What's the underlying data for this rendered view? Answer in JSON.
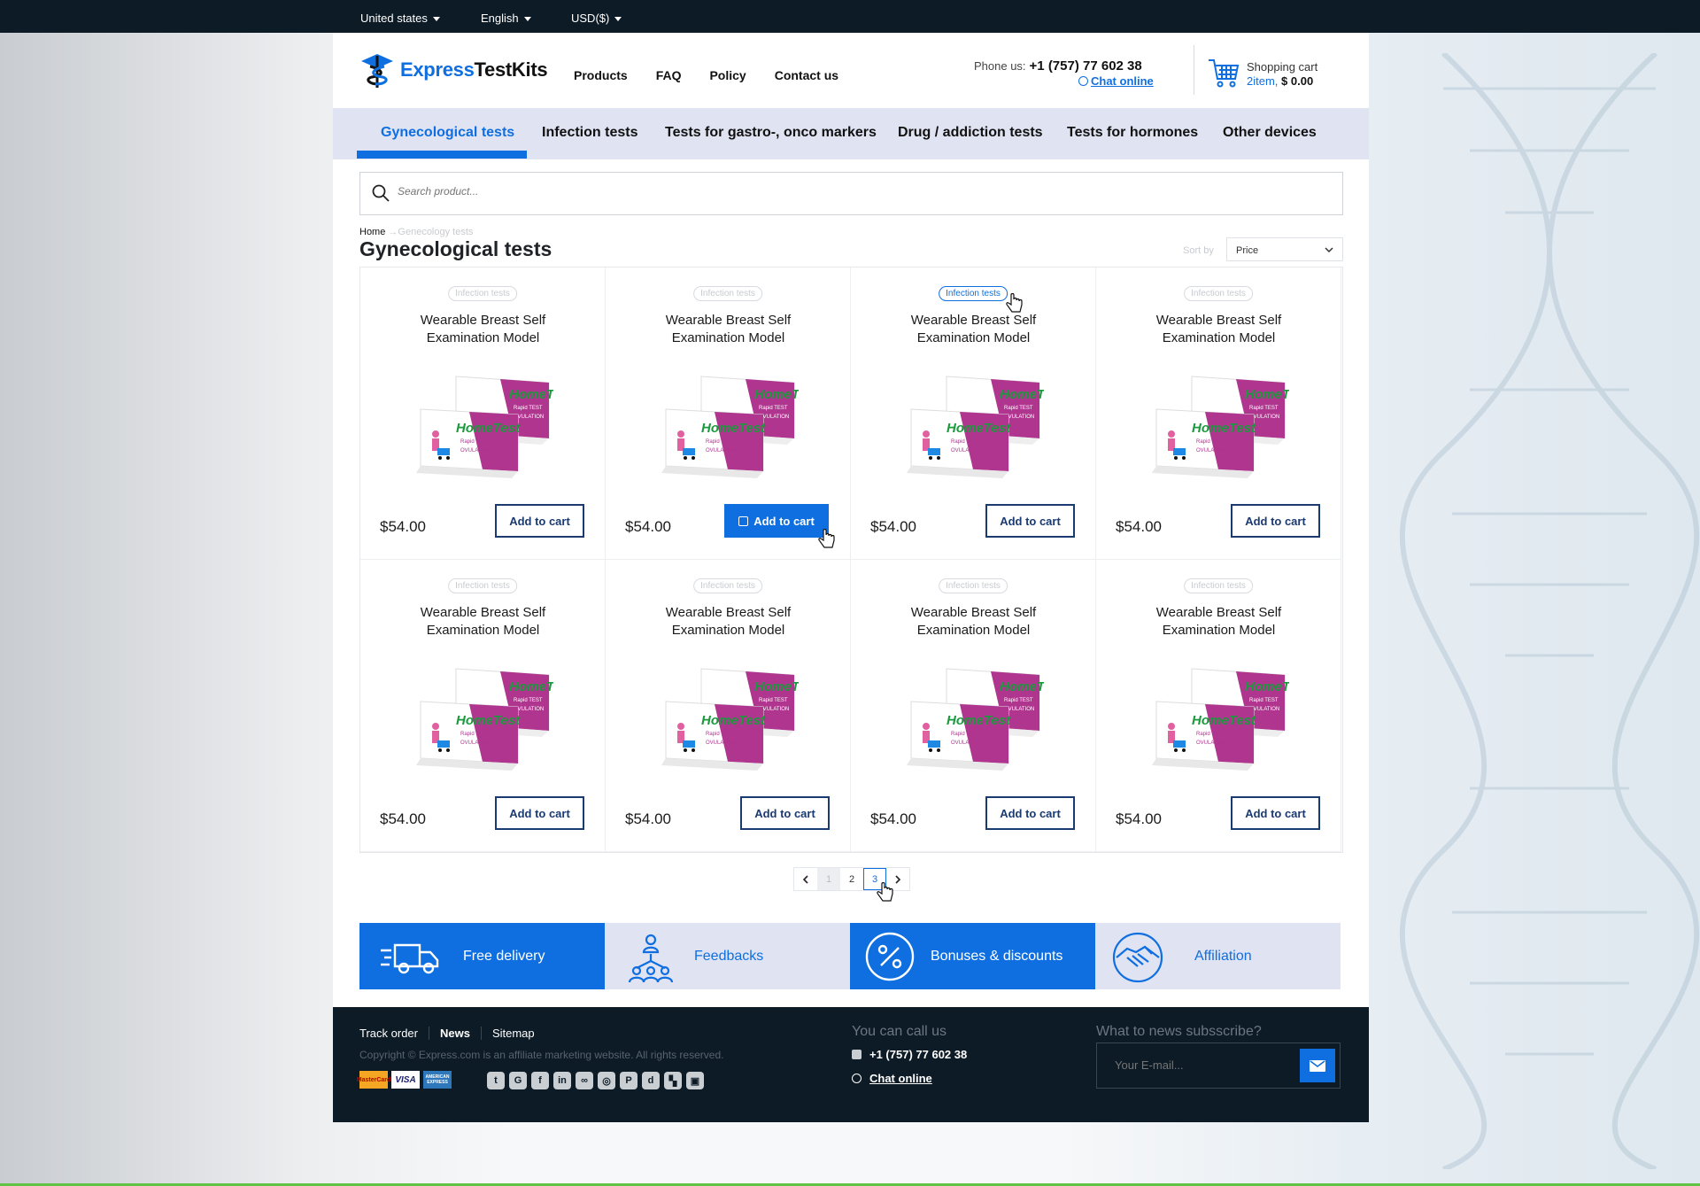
{
  "topbar": {
    "country": "United states",
    "language": "English",
    "currency": "USD($)"
  },
  "header": {
    "logo": {
      "part1": "Express",
      "part2": "TestKits"
    },
    "nav": [
      "Products",
      "FAQ",
      "Policy",
      "Contact us"
    ],
    "phone_label": "Phone us:",
    "phone_number": "+1 (757) 77 602 38",
    "chat": "Chat online",
    "cart_label": "Shopping cart",
    "cart_items": "2item,",
    "cart_total": "$ 0.00"
  },
  "categories": [
    {
      "label": "Gynecological tests",
      "active": true
    },
    {
      "label": "Infection tests",
      "active": false
    },
    {
      "label": "Tests for gastro-, onco markers",
      "active": false
    },
    {
      "label": "Drug / addiction tests",
      "active": false
    },
    {
      "label": "Tests for hormones",
      "active": false
    },
    {
      "label": "Other devices",
      "active": false
    }
  ],
  "search": {
    "placeholder": "Search product..."
  },
  "breadcrumb": {
    "home": "Home",
    "current": "Genecology tests"
  },
  "page_title": "Gynecological tests",
  "sort": {
    "label": "Sort by",
    "value": "Price"
  },
  "products": [
    {
      "badge": "Infection tests",
      "name_line1": "Wearable Breast Self",
      "name_line2": "Examination Model",
      "price": "$54.00",
      "button": "Add to cart"
    },
    {
      "badge": "Infection tests",
      "name_line1": "Wearable Breast Self",
      "name_line2": "Examination Model",
      "price": "$54.00",
      "button": "Add to cart"
    },
    {
      "badge": "Infection tests",
      "name_line1": "Wearable Breast Self",
      "name_line2": "Examination Model",
      "price": "$54.00",
      "button": "Add to cart"
    },
    {
      "badge": "Infection tests",
      "name_line1": "Wearable Breast Self",
      "name_line2": "Examination Model",
      "price": "$54.00",
      "button": "Add to cart"
    },
    {
      "badge": "Infection tests",
      "name_line1": "Wearable Breast Self",
      "name_line2": "Examination Model",
      "price": "$54.00",
      "button": "Add to cart"
    },
    {
      "badge": "Infection tests",
      "name_line1": "Wearable Breast Self",
      "name_line2": "Examination Model",
      "price": "$54.00",
      "button": "Add to cart"
    },
    {
      "badge": "Infection tests",
      "name_line1": "Wearable Breast Self",
      "name_line2": "Examination Model",
      "price": "$54.00",
      "button": "Add to cart"
    },
    {
      "badge": "Infection tests",
      "name_line1": "Wearable Breast Self",
      "name_line2": "Examination Model",
      "price": "$54.00",
      "button": "Add to cart"
    }
  ],
  "product_image": {
    "brand": "HomeTest",
    "line1": "Rapid TEST",
    "line2": "OVULATION"
  },
  "pagination": {
    "pages": [
      "1",
      "2",
      "3"
    ],
    "current": "3"
  },
  "features": [
    "Free delivery",
    "Feedbacks",
    "Bonuses & discounts",
    "Affiliation"
  ],
  "footer": {
    "links": [
      "Track order",
      "News",
      "Sitemap"
    ],
    "copyright": "Copyright © Express.com is an affiliate marketing website. All rights reserved.",
    "payment_cards": [
      "MasterCard",
      "VISA",
      "AMERICAN EXPRESS"
    ],
    "call_heading": "You can call us",
    "call_phone": "+1 (757) 77 602 38",
    "chat": "Chat online",
    "subscribe_heading": "What to news subsscribe?",
    "email_placeholder": "Your E-mail..."
  },
  "colors": {
    "accent": "#0f6fe0",
    "dark": "#0d1b26",
    "nav_bg": "#e0e3f2",
    "box_purple": "#b0358f",
    "brand_green": "#1a9a3c"
  }
}
